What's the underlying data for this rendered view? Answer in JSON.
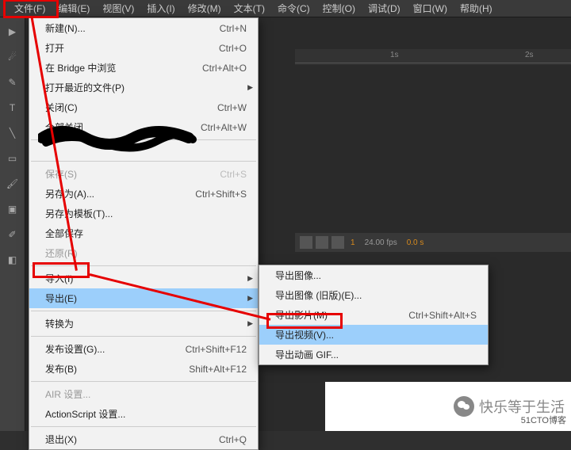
{
  "menubar": {
    "items": [
      {
        "label": "文件(F)"
      },
      {
        "label": "编辑(E)"
      },
      {
        "label": "视图(V)"
      },
      {
        "label": "插入(I)"
      },
      {
        "label": "修改(M)"
      },
      {
        "label": "文本(T)"
      },
      {
        "label": "命令(C)"
      },
      {
        "label": "控制(O)"
      },
      {
        "label": "调试(D)"
      },
      {
        "label": "窗口(W)"
      },
      {
        "label": "帮助(H)"
      }
    ]
  },
  "timeline": {
    "labels": [
      "1s",
      "2s"
    ]
  },
  "status": {
    "frame": "1",
    "fps": "24.00 fps",
    "time": "0.0 s"
  },
  "file_menu": {
    "items": [
      {
        "label": "新建(N)...",
        "shortcut": "Ctrl+N"
      },
      {
        "label": "打开",
        "shortcut": "Ctrl+O"
      },
      {
        "label": "在 Bridge 中浏览",
        "shortcut": "Ctrl+Alt+O"
      },
      {
        "label": "打开最近的文件(P)",
        "submenu": true
      },
      {
        "label": "关闭(C)",
        "shortcut": "Ctrl+W"
      },
      {
        "label": "全部关闭",
        "shortcut": "Ctrl+Alt+W"
      },
      {
        "separator": true
      },
      {
        "label": "…",
        "shortcut": "",
        "hidden": true
      },
      {
        "separator": true
      },
      {
        "label": "保存(S)",
        "shortcut": "Ctrl+S",
        "disabled": true
      },
      {
        "label": "另存为(A)...",
        "shortcut": "Ctrl+Shift+S"
      },
      {
        "label": "另存为模板(T)..."
      },
      {
        "label": "全部保存"
      },
      {
        "label": "还原(R)",
        "disabled": true
      },
      {
        "separator": true
      },
      {
        "label": "导入(I)",
        "submenu": true
      },
      {
        "label": "导出(E)",
        "submenu": true,
        "highlighted": true
      },
      {
        "separator": true
      },
      {
        "label": "转换为",
        "submenu": true
      },
      {
        "separator": true
      },
      {
        "label": "发布设置(G)...",
        "shortcut": "Ctrl+Shift+F12"
      },
      {
        "label": "发布(B)",
        "shortcut": "Shift+Alt+F12"
      },
      {
        "separator": true
      },
      {
        "label": "AIR 设置...",
        "disabled": true
      },
      {
        "label": "ActionScript 设置..."
      },
      {
        "separator": true
      },
      {
        "label": "退出(X)",
        "shortcut": "Ctrl+Q"
      }
    ]
  },
  "export_submenu": {
    "items": [
      {
        "label": "导出图像..."
      },
      {
        "label": "导出图像 (旧版)(E)..."
      },
      {
        "label": "导出影片(M)",
        "shortcut": "Ctrl+Shift+Alt+S"
      },
      {
        "label": "导出视频(V)...",
        "highlighted": true
      },
      {
        "label": "导出动画 GIF..."
      }
    ]
  },
  "wechat": {
    "text": "快乐等于生活"
  },
  "watermark": "51CTO博客"
}
